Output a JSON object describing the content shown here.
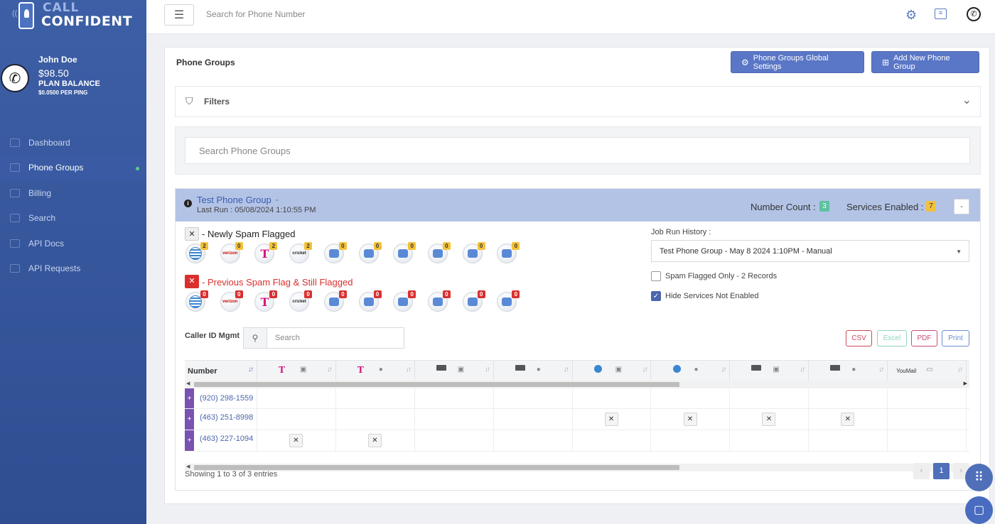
{
  "app": {
    "logo_top": "CALL",
    "logo_bottom": "CONFIDENT"
  },
  "user": {
    "name": "John Doe",
    "balance": "$98.50",
    "plan_label": "PLAN BALANCE",
    "rate": "$0.0500 PER PING"
  },
  "nav": {
    "items": [
      {
        "label": "Dashboard",
        "icon": "chart-area-icon"
      },
      {
        "label": "Phone Groups",
        "icon": "phone-groups-icon",
        "active": true
      },
      {
        "label": "Billing",
        "icon": "billing-icon"
      },
      {
        "label": "Search",
        "icon": "search-icon"
      },
      {
        "label": "API Docs",
        "icon": "document-icon"
      },
      {
        "label": "API Requests",
        "icon": "document-icon"
      }
    ]
  },
  "topbar": {
    "search_placeholder": "Search for Phone Number",
    "icons": [
      "gear-icon",
      "list-icon",
      "phone-icon"
    ]
  },
  "page": {
    "title": "Phone Groups",
    "global_settings_button": "Phone Groups Global Settings",
    "add_group_button": "Add New Phone Group",
    "filters_label": "Filters",
    "group_search_placeholder": "Search Phone Groups"
  },
  "group": {
    "name": "Test Phone Group",
    "last_run": "Last Run : 05/08/2024 1:10:55 PM",
    "number_count_label": "Number Count :",
    "number_count": "3",
    "services_label": "Services Enabled :",
    "services_count": "7",
    "collapse_label": "-",
    "newly_label": "- Newly Spam Flagged",
    "previous_label": "- Previous Spam Flag & Still Flagged",
    "newly_carriers": [
      {
        "name": "att",
        "count": "2"
      },
      {
        "name": "verizon",
        "count": "0"
      },
      {
        "name": "tmobile",
        "count": "2"
      },
      {
        "name": "cricket",
        "count": "2"
      },
      {
        "name": "youmail",
        "count": "0"
      },
      {
        "name": "startpoint",
        "count": "0"
      },
      {
        "name": "robokiller",
        "count": "0"
      },
      {
        "name": "nomorobo",
        "count": "0"
      },
      {
        "name": "hiya",
        "count": "0"
      },
      {
        "name": "truecaller",
        "count": "0"
      }
    ],
    "previous_carriers": [
      {
        "name": "att",
        "count": "0"
      },
      {
        "name": "verizon",
        "count": "0"
      },
      {
        "name": "tmobile",
        "count": "0"
      },
      {
        "name": "cricket",
        "count": "0"
      },
      {
        "name": "youmail",
        "count": "0"
      },
      {
        "name": "startpoint",
        "count": "0"
      },
      {
        "name": "robokiller",
        "count": "0"
      },
      {
        "name": "nomorobo",
        "count": "0"
      },
      {
        "name": "hiya",
        "count": "0"
      },
      {
        "name": "truecaller",
        "count": "0"
      }
    ],
    "job_history_label": "Job Run History :",
    "job_history_value": "Test Phone Group - May 8 2024 1:10PM - Manual",
    "spam_only_label": "Spam Flagged Only - 2 Records",
    "hide_services_label": "Hide Services Not Enabled",
    "caller_id_label": "Caller ID Mgmt",
    "caller_search_placeholder": "Search",
    "export_buttons": [
      "CSV",
      "Excel",
      "PDF",
      "Print"
    ]
  },
  "table": {
    "number_header": "Number",
    "youmail_header": "YouMail",
    "rows": [
      {
        "number": "(920) 298-1559",
        "flags": []
      },
      {
        "number": "(463) 251-8998",
        "flags": [
          5,
          6,
          7,
          8
        ]
      },
      {
        "number": "(463) 227-1094",
        "flags": [
          1,
          2
        ]
      }
    ],
    "showing": "Showing 1 to 3 of 3 entries",
    "page": "1"
  },
  "colors": {
    "sidebar": "#3d5fa6",
    "primary": "#5a76c6",
    "group_header": "#b3c3e6",
    "badge_yellow": "#f3c13a",
    "badge_red": "#d9302f",
    "tmobile": "#d8147b"
  }
}
